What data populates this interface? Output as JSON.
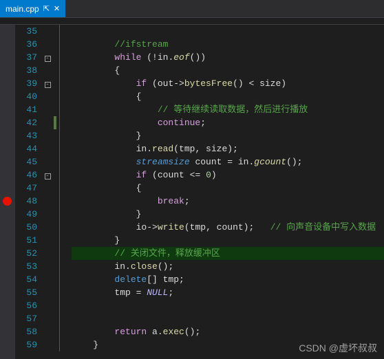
{
  "tab": {
    "filename": "main.cpp",
    "pin": "⇱",
    "close": "✕"
  },
  "breakpoint_line": 48,
  "highlighted_line": 52,
  "marker_line": 42,
  "fold_lines": {
    "37": "-",
    "39": "-",
    "46": "-"
  },
  "lines": [
    {
      "n": 35,
      "indent": 2,
      "tokens": []
    },
    {
      "n": 36,
      "indent": 2,
      "tokens": [
        [
          "cm",
          "//ifstream"
        ]
      ]
    },
    {
      "n": 37,
      "indent": 2,
      "tokens": [
        [
          "flow",
          "while"
        ],
        [
          "p",
          " (!in."
        ],
        [
          "fn-i",
          "eof"
        ],
        [
          "p",
          "())"
        ]
      ]
    },
    {
      "n": 38,
      "indent": 2,
      "tokens": [
        [
          "p",
          "{"
        ]
      ]
    },
    {
      "n": 39,
      "indent": 3,
      "tokens": [
        [
          "flow",
          "if"
        ],
        [
          "p",
          " (out->"
        ],
        [
          "fn",
          "bytesFree"
        ],
        [
          "p",
          "() < size)"
        ]
      ]
    },
    {
      "n": 40,
      "indent": 3,
      "tokens": [
        [
          "p",
          "{"
        ]
      ]
    },
    {
      "n": 41,
      "indent": 4,
      "tokens": [
        [
          "cm",
          "// 等待继续读取数据，然后进行播放"
        ]
      ]
    },
    {
      "n": 42,
      "indent": 4,
      "tokens": [
        [
          "flow",
          "continue"
        ],
        [
          "p",
          ";"
        ]
      ]
    },
    {
      "n": 43,
      "indent": 3,
      "tokens": [
        [
          "p",
          "}"
        ]
      ]
    },
    {
      "n": 44,
      "indent": 3,
      "tokens": [
        [
          "id",
          "in."
        ],
        [
          "fn",
          "read"
        ],
        [
          "p",
          "(tmp, size);"
        ]
      ]
    },
    {
      "n": 45,
      "indent": 3,
      "tokens": [
        [
          "kw2",
          "streamsize"
        ],
        [
          "p",
          " count = in."
        ],
        [
          "fn-i",
          "gcount"
        ],
        [
          "p",
          "();"
        ]
      ]
    },
    {
      "n": 46,
      "indent": 3,
      "tokens": [
        [
          "flow",
          "if"
        ],
        [
          "p",
          " (count <= "
        ],
        [
          "num",
          "0"
        ],
        [
          "p",
          ")"
        ]
      ]
    },
    {
      "n": 47,
      "indent": 3,
      "tokens": [
        [
          "p",
          "{"
        ]
      ]
    },
    {
      "n": 48,
      "indent": 4,
      "tokens": [
        [
          "flow",
          "break"
        ],
        [
          "p",
          ";"
        ]
      ]
    },
    {
      "n": 49,
      "indent": 3,
      "tokens": [
        [
          "p",
          "}"
        ]
      ]
    },
    {
      "n": 50,
      "indent": 3,
      "tokens": [
        [
          "id",
          "io->"
        ],
        [
          "fn",
          "write"
        ],
        [
          "p",
          "(tmp, count);   "
        ],
        [
          "cm",
          "// 向声音设备中写入数据"
        ]
      ]
    },
    {
      "n": 51,
      "indent": 2,
      "tokens": [
        [
          "p",
          "}"
        ]
      ]
    },
    {
      "n": 52,
      "indent": 2,
      "tokens": [
        [
          "cm",
          "// 关闭文件，释放缓冲区"
        ]
      ]
    },
    {
      "n": 53,
      "indent": 2,
      "tokens": [
        [
          "id",
          "in."
        ],
        [
          "fn",
          "close"
        ],
        [
          "p",
          "();"
        ]
      ]
    },
    {
      "n": 54,
      "indent": 2,
      "tokens": [
        [
          "kw",
          "delete"
        ],
        [
          "p",
          "[] tmp;"
        ]
      ]
    },
    {
      "n": 55,
      "indent": 2,
      "tokens": [
        [
          "id",
          "tmp = "
        ],
        [
          "mac",
          "NULL"
        ],
        [
          "p",
          ";"
        ]
      ]
    },
    {
      "n": 56,
      "indent": 0,
      "tokens": []
    },
    {
      "n": 57,
      "indent": 0,
      "tokens": []
    },
    {
      "n": 58,
      "indent": 2,
      "tokens": [
        [
          "flow",
          "return"
        ],
        [
          "p",
          " a."
        ],
        [
          "fn",
          "exec"
        ],
        [
          "p",
          "();"
        ]
      ]
    },
    {
      "n": 59,
      "indent": 1,
      "tokens": [
        [
          "p",
          "}"
        ]
      ]
    }
  ],
  "indent_unit": "    ",
  "watermark": "CSDN @虚坏叔叔"
}
